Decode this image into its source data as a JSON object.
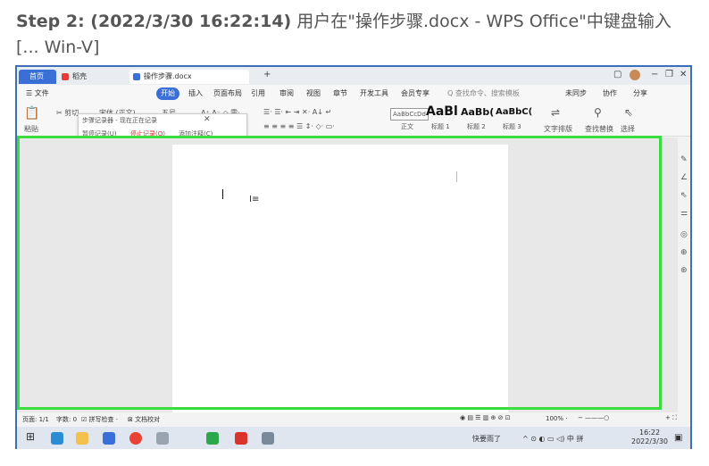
{
  "header": {
    "step": "Step 2: (2022/3/30 16:22:14)",
    "description": "用户在\"操作步骤.docx - WPS Office\"中键盘输入 [... Win-V]"
  },
  "tabs": [
    {
      "label": "首页"
    },
    {
      "label": "稻壳"
    },
    {
      "label": "操作步骤.docx"
    }
  ],
  "menu": [
    "☰ 文件",
    "开始",
    "插入",
    "页面布局",
    "引用",
    "审阅",
    "视图",
    "章节",
    "开发工具",
    "会员专享",
    "Q 查找命令、搜索模板",
    "未同步",
    "协作",
    "分享"
  ],
  "ribbon": {
    "paste": "粘贴",
    "cut": "✂ 剪切",
    "font": "宋体 (正文)",
    "size": "五号",
    "styles": [
      "AaBbCcDd",
      "AaBl",
      "AaBb(",
      "AaBbC("
    ],
    "style_labels": [
      "正文",
      "标题 1",
      "标题 2",
      "标题 3"
    ],
    "tools": [
      "文字排版",
      "查找替换",
      "选择"
    ]
  },
  "recorder": {
    "title": "步骤记录器 - 现在正在记录",
    "pause": "暂停记录(U)",
    "stop": "停止记录(O)",
    "comment": "添加注释(C)"
  },
  "status": {
    "page": "页面: 1/1",
    "words": "字数: 0",
    "spell": "☑ 拼写检查 ·",
    "check": "⊠ 文档校对",
    "zoom": "100% ·"
  },
  "taskbar": {
    "weather": "快要雨了",
    "time": "16:22",
    "date": "2022/3/30"
  },
  "colors": {
    "accent": "#3a6fd8",
    "highlight": "#3cdc3c",
    "window_border": "#3b6fb6"
  }
}
